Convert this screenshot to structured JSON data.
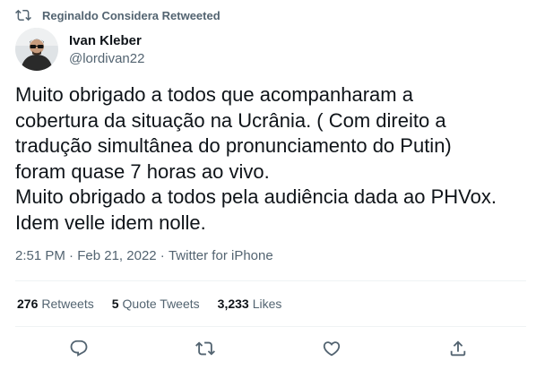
{
  "retweet_context": {
    "icon": "retweet-icon",
    "text": "Reginaldo Considera Retweeted"
  },
  "author": {
    "display_name": "Ivan Kleber",
    "handle": "@lordivan22",
    "avatar": "avatar-photo"
  },
  "tweet": {
    "text": "Muito obrigado a todos que acompanharam a\ncobertura da situação na Ucrânia. ( Com direito a\ntradução simultânea do pronunciamento do Putin)\nforam quase 7 horas ao vivo.\nMuito obrigado a todos pela audiência dada ao PHVox.\nIdem velle idem nolle."
  },
  "meta": {
    "time": "2:51 PM",
    "separator": " · ",
    "date": "Feb 21, 2022",
    "source": "Twitter for iPhone"
  },
  "stats": [
    {
      "count": "276",
      "label": "Retweets"
    },
    {
      "count": "5",
      "label": "Quote Tweets"
    },
    {
      "count": "3,233",
      "label": "Likes"
    }
  ],
  "actions": [
    {
      "name": "reply",
      "icon": "reply-icon"
    },
    {
      "name": "retweet",
      "icon": "retweet-icon"
    },
    {
      "name": "like",
      "icon": "heart-icon"
    },
    {
      "name": "share",
      "icon": "share-icon"
    }
  ],
  "colors": {
    "primary_text": "#0f1419",
    "secondary_text": "#536471",
    "divider": "#eff3f4"
  }
}
